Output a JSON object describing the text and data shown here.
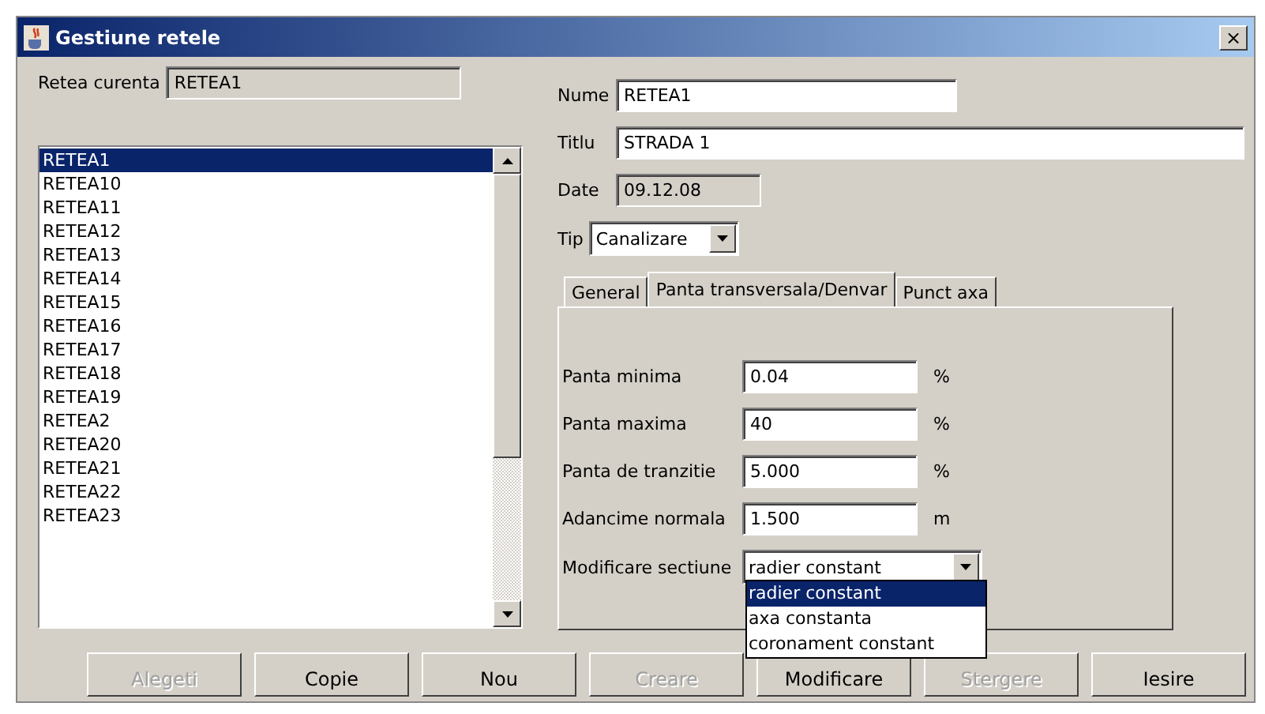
{
  "window": {
    "title": "Gestiune retele",
    "close": "×"
  },
  "current": {
    "label": "Retea curenta",
    "value": "RETEA1"
  },
  "networks": [
    {
      "name": "RETEA1",
      "selected": true
    },
    {
      "name": "RETEA10",
      "selected": false
    },
    {
      "name": "RETEA11",
      "selected": false
    },
    {
      "name": "RETEA12",
      "selected": false
    },
    {
      "name": "RETEA13",
      "selected": false
    },
    {
      "name": "RETEA14",
      "selected": false
    },
    {
      "name": "RETEA15",
      "selected": false
    },
    {
      "name": "RETEA16",
      "selected": false
    },
    {
      "name": "RETEA17",
      "selected": false
    },
    {
      "name": "RETEA18",
      "selected": false
    },
    {
      "name": "RETEA19",
      "selected": false
    },
    {
      "name": "RETEA2",
      "selected": false
    },
    {
      "name": "RETEA20",
      "selected": false
    },
    {
      "name": "RETEA21",
      "selected": false
    },
    {
      "name": "RETEA22",
      "selected": false
    },
    {
      "name": "RETEA23",
      "selected": false
    }
  ],
  "form": [
    {
      "label": "Nume",
      "value": "RETEA1",
      "kind": "text",
      "disabled": false
    },
    {
      "label": "Titlu",
      "value": "STRADA 1",
      "kind": "wide",
      "disabled": false
    },
    {
      "label": "Date",
      "value": "09.12.08",
      "kind": "short",
      "disabled": true
    }
  ],
  "tip": {
    "label": "Tip",
    "value": "Canalizare"
  },
  "tabs": [
    {
      "label": "General",
      "selected": false
    },
    {
      "label": "Panta transversala/Denvar",
      "selected": true
    },
    {
      "label": "Punct axa",
      "selected": false
    }
  ],
  "params": [
    {
      "label": "Panta minima",
      "value": "0.04",
      "unit": "%"
    },
    {
      "label": "Panta maxima",
      "value": "40",
      "unit": "%"
    },
    {
      "label": "Panta de tranzitie",
      "value": "5.000",
      "unit": "%"
    },
    {
      "label": "Adancime normala",
      "value": "1.500",
      "unit": "m"
    }
  ],
  "section": {
    "label": "Modificare sectiune",
    "value": "radier constant",
    "options": [
      {
        "label": "radier constant",
        "selected": true
      },
      {
        "label": "axa constanta",
        "selected": false
      },
      {
        "label": "coronament constant",
        "selected": false
      }
    ]
  },
  "buttons": [
    {
      "label": "Alegeti",
      "disabled": true
    },
    {
      "label": "Copie",
      "disabled": false
    },
    {
      "label": "Nou",
      "disabled": false
    },
    {
      "label": "Creare",
      "disabled": true
    },
    {
      "label": "Modificare",
      "disabled": false
    },
    {
      "label": "Stergere",
      "disabled": true
    },
    {
      "label": "Iesire",
      "disabled": false
    }
  ]
}
